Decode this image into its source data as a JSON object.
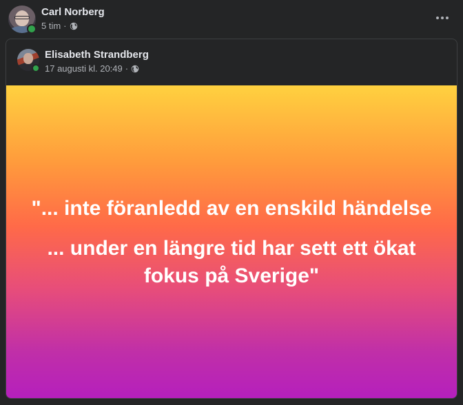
{
  "post": {
    "author": "Carl Norberg",
    "time": "5 tim",
    "separator": "·",
    "audience_icon": "globe-icon",
    "more_icon": "more-options-icon"
  },
  "shared": {
    "author": "Elisabeth Strandberg",
    "time": "17 augusti kl. 20:49",
    "separator": "·",
    "audience_icon": "globe-icon",
    "quote_lines": [
      "\"... inte föranledd av en enskild händelse",
      "... under en längre tid har sett ett ökat fokus på Sverige\""
    ]
  },
  "colors": {
    "background": "#242526",
    "online": "#31a24c",
    "gradient_top": "#ffd13f",
    "gradient_bottom": "#b51fbd"
  }
}
